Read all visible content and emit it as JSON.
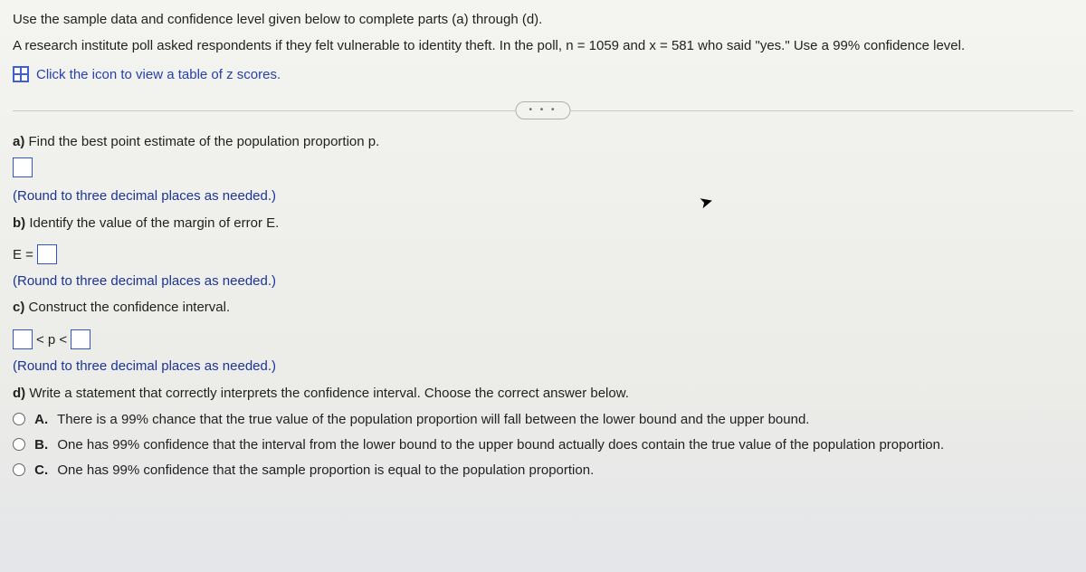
{
  "intro": {
    "line1": "Use the sample data and confidence level given below to complete parts (a) through (d).",
    "line2": "A research institute poll asked respondents if they felt vulnerable to identity theft. In the poll, n = 1059 and x = 581 who said \"yes.\" Use a 99% confidence level."
  },
  "link": {
    "text": "Click the icon to view a table of z scores."
  },
  "more_button": "• • •",
  "parts": {
    "a": {
      "label": "a)",
      "prompt": "Find the best point estimate of the population proportion p.",
      "hint": "(Round to three decimal places as needed.)"
    },
    "b": {
      "label": "b)",
      "prompt": "Identify the value of the margin of error E.",
      "eq_prefix": "E =",
      "hint": "(Round to three decimal places as needed.)"
    },
    "c": {
      "label": "c)",
      "prompt": "Construct the confidence interval.",
      "mid": "< p <",
      "hint": "(Round to three decimal places as needed.)"
    },
    "d": {
      "label": "d)",
      "prompt": "Write a statement that correctly interprets the confidence interval. Choose the correct answer below."
    }
  },
  "options": {
    "A": {
      "label": "A.",
      "text": "There is a 99% chance that the true value of the population proportion will fall between the lower bound and the upper bound."
    },
    "B": {
      "label": "B.",
      "text": "One has 99% confidence that the interval from the lower bound to the upper bound actually does contain the true value of the population proportion."
    },
    "C": {
      "label": "C.",
      "text": "One has 99% confidence that the sample proportion is equal to the population proportion."
    }
  }
}
